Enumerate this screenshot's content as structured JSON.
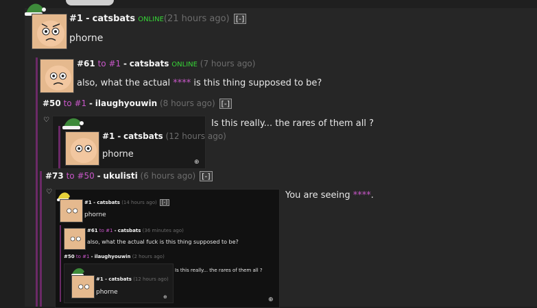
{
  "posts": {
    "p1": {
      "id": "#1",
      "user": "catsbats",
      "status": "ONLINE",
      "time": "(21 hours ago)",
      "button": "[-]",
      "body": "phorne"
    },
    "p61": {
      "id": "#61",
      "to": "to #1",
      "user": "catsbats",
      "status": "ONLINE",
      "time": "(7 hours ago)",
      "body_pre": "also, what the actual ",
      "body_stars": "****",
      "body_post": " is this thing supposed to be?"
    },
    "p50": {
      "id": "#50",
      "to": "to #1",
      "user": "ilaughyouwin",
      "time": "(8 hours ago)",
      "button": "[-]",
      "body": "Is this really... the rares of them all ?"
    },
    "p50_quote": {
      "id": "#1",
      "user": "catsbats",
      "time": "(12 hours ago)",
      "body": "phorne"
    },
    "p73": {
      "id": "#73",
      "to": "to #50",
      "user": "ukulisti",
      "time": "(6 hours ago)",
      "button": "[-]",
      "body_pre": "You are seeing ",
      "body_stars": "****",
      "body_post": "."
    }
  },
  "screenshot": {
    "q1": {
      "id": "#1 -",
      "user": "catsbats",
      "time": "(14 hours ago)",
      "button": "[-]",
      "body": "phorne"
    },
    "q61": {
      "id": "#61",
      "to": "to #1",
      "user": "catsbats",
      "time": "(36 minutes ago)",
      "body": "also, what the actual fuck is this thing supposed to be?"
    },
    "q50": {
      "id": "#50",
      "to": "to #1",
      "user": "ilaughyouwin",
      "time": "(2 hours ago)",
      "body": "Is this really... the rares of them all ?"
    },
    "q50q": {
      "id": "#1 -",
      "user": "catsbats",
      "time": "(12 hours ago)",
      "body": "phorne"
    }
  },
  "separator": "-",
  "icons": {
    "zoom": "zoom-in-icon",
    "heart": "heart-icon",
    "hat": "santa-hat-icon",
    "avatar": "cat-avatar"
  },
  "colors": {
    "background": "#262626",
    "online": "#36d636",
    "reply_link": "#c957c9",
    "thread_line": "#6b2a67"
  }
}
